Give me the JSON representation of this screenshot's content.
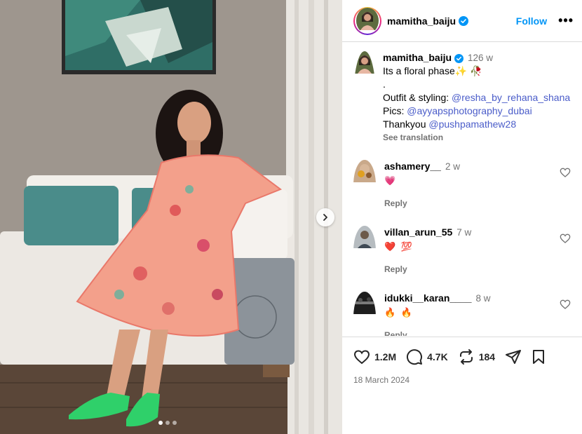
{
  "post": {
    "username": "mamitha_baiju",
    "follow_label": "Follow",
    "more_label": "•••",
    "caption": {
      "time": "126 w",
      "line1": "Its a floral phase",
      "line1_emoji": "✨ 🥀",
      "dot": ".",
      "outfit_prefix": "Outfit & styling: ",
      "outfit_mention": "@resha_by_rehana_shana",
      "pics_prefix": "Pics: ",
      "pics_mention": "@ayyapsphotography_dubai",
      "thanks_prefix": "Thankyou ",
      "thanks_mention": "@pushpamathew28",
      "see_translation": "See translation"
    },
    "comments": [
      {
        "username": "ashamery__",
        "time": "2 w",
        "text": "💗",
        "reply": "Reply"
      },
      {
        "username": "villan_arun_55",
        "time": "7 w",
        "text": "❤️ 💯",
        "reply": "Reply"
      },
      {
        "username": "idukki__karan____",
        "time": "8 w",
        "text": "🔥 🔥",
        "reply": "Reply"
      }
    ],
    "stats": {
      "likes": "1.2M",
      "comments": "4.7K",
      "reposts": "184"
    },
    "date": "18 March 2024",
    "carousel": {
      "total": 3,
      "active_index": 0
    }
  },
  "colors": {
    "accent": "#0095f6",
    "verified": "#0095f6",
    "muted": "#737373",
    "mention": "#4a5cc9"
  },
  "icons": {
    "like": "heart-icon",
    "comment": "comment-bubble-icon",
    "repost": "repost-icon",
    "share": "send-icon",
    "save": "bookmark-icon",
    "next": "chevron-right-icon"
  }
}
